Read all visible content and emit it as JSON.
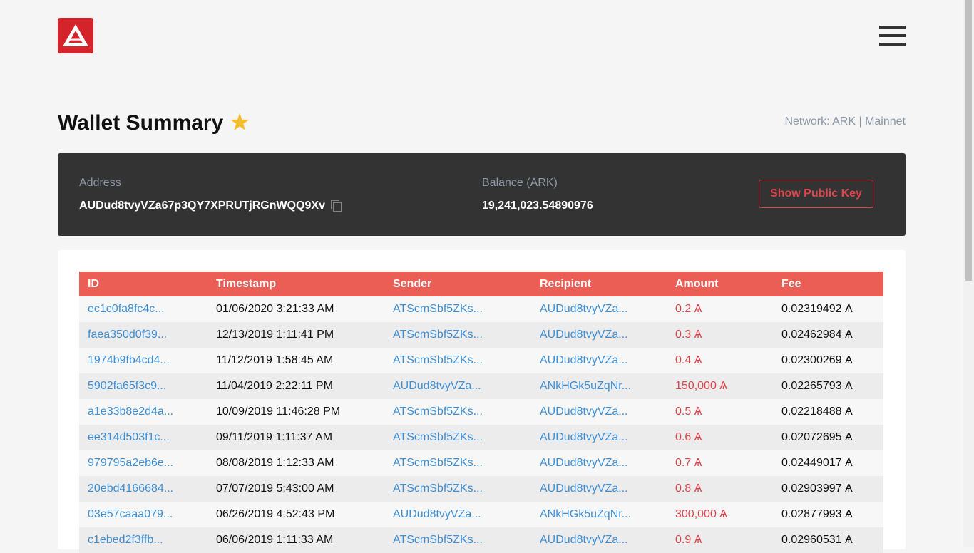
{
  "header": {
    "logo_icon": "ark-logo-icon",
    "menu_icon": "hamburger-menu-icon"
  },
  "page": {
    "title": "Wallet Summary",
    "star": "★",
    "network": "Network: ARK | Mainnet"
  },
  "summary": {
    "address_label": "Address",
    "address": "AUDud8tvyVZa67p3QY7XPRUTjRGnWQQ9Xv",
    "balance_label": "Balance (ARK)",
    "balance": "19,241,023.54890976",
    "public_key_button": "Show Public Key"
  },
  "table": {
    "headers": [
      "ID",
      "Timestamp",
      "Sender",
      "Recipient",
      "Amount",
      "Fee"
    ],
    "rows": [
      [
        "ec1c0fa8fc4c...",
        "01/06/2020 3:21:33 AM",
        "ATScmSbf5ZKs...",
        "AUDud8tvyVZa...",
        "0.2 Ѧ",
        "0.02319492 Ѧ"
      ],
      [
        "faea350d0f39...",
        "12/13/2019 1:11:41 PM",
        "ATScmSbf5ZKs...",
        "AUDud8tvyVZa...",
        "0.3 Ѧ",
        "0.02462984 Ѧ"
      ],
      [
        "1974b9fb4cd4...",
        "11/12/2019 1:58:45 AM",
        "ATScmSbf5ZKs...",
        "AUDud8tvyVZa...",
        "0.4 Ѧ",
        "0.02300269 Ѧ"
      ],
      [
        "5902fa65f3c9...",
        "11/04/2019 2:22:11 PM",
        "AUDud8tvyVZa...",
        "ANkHGk5uZqNr...",
        "150,000 Ѧ",
        "0.02265793 Ѧ"
      ],
      [
        "a1e33b8e2d4a...",
        "10/09/2019 11:46:28 PM",
        "ATScmSbf5ZKs...",
        "AUDud8tvyVZa...",
        "0.5 Ѧ",
        "0.02218488 Ѧ"
      ],
      [
        "ee314d503f1c...",
        "09/11/2019 1:11:37 AM",
        "ATScmSbf5ZKs...",
        "AUDud8tvyVZa...",
        "0.6 Ѧ",
        "0.02072695 Ѧ"
      ],
      [
        "979795a2eb6e...",
        "08/08/2019 1:12:33 AM",
        "ATScmSbf5ZKs...",
        "AUDud8tvyVZa...",
        "0.7 Ѧ",
        "0.02449017 Ѧ"
      ],
      [
        "20ebd4166684...",
        "07/07/2019 5:43:00 AM",
        "ATScmSbf5ZKs...",
        "AUDud8tvyVZa...",
        "0.8 Ѧ",
        "0.02903997 Ѧ"
      ],
      [
        "03e57caaa079...",
        "06/26/2019 4:52:43 PM",
        "AUDud8tvyVZa...",
        "ANkHGk5uZqNr...",
        "300,000 Ѧ",
        "0.02877993 Ѧ"
      ],
      [
        "c1ebed2f3ffb...",
        "06/06/2019 1:11:33 AM",
        "ATScmSbf5ZKs...",
        "AUDud8tvyVZa...",
        "0.9 Ѧ",
        "0.02960531 Ѧ"
      ]
    ]
  },
  "colors": {
    "brand_red": "#d4232b",
    "header_row": "#eb5e55",
    "link": "#3d8fd6",
    "amount": "#e0444d",
    "star": "#f4bd2c"
  }
}
